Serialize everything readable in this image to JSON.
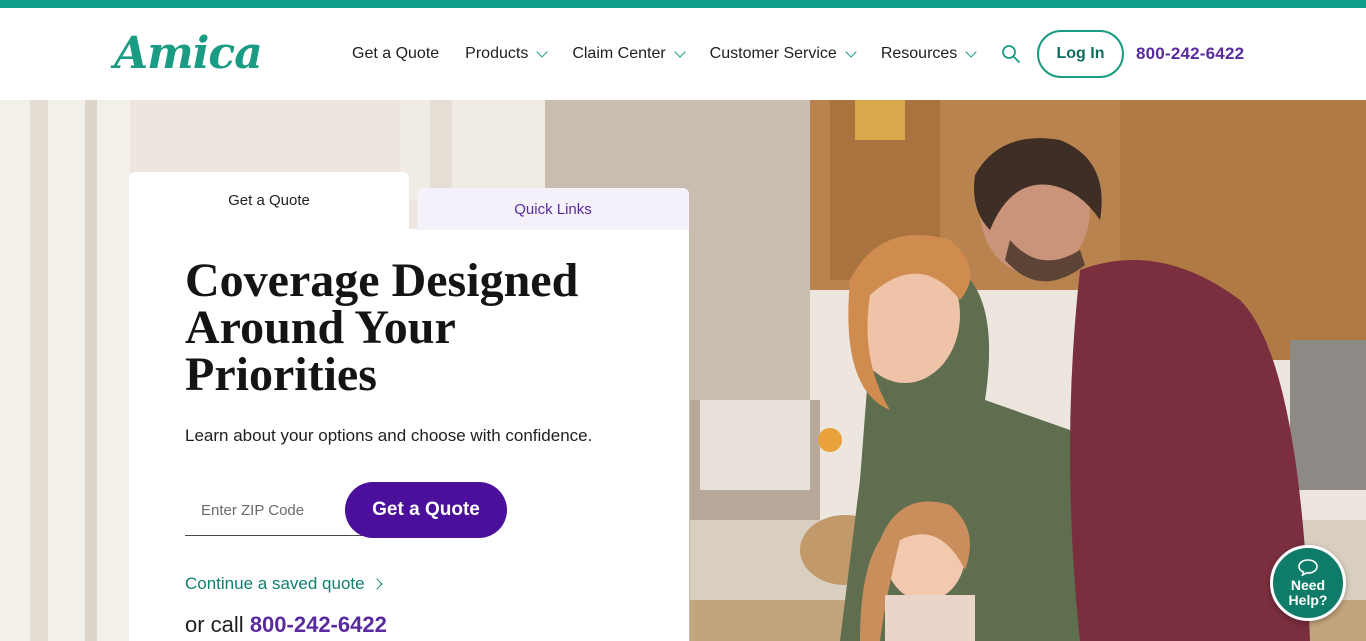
{
  "brand": {
    "logo_text": "Amica",
    "accent": "#0f9f8a",
    "purple": "#4b0f9b"
  },
  "nav": {
    "items": [
      {
        "label": "Get a Quote",
        "has_dropdown": false
      },
      {
        "label": "Products",
        "has_dropdown": true
      },
      {
        "label": "Claim Center",
        "has_dropdown": true
      },
      {
        "label": "Customer Service",
        "has_dropdown": true
      },
      {
        "label": "Resources",
        "has_dropdown": true
      }
    ],
    "search_icon": "search-icon",
    "login_label": "Log In",
    "phone": "800-242-6422"
  },
  "tabs": {
    "quote": "Get a Quote",
    "links": "Quick Links"
  },
  "hero": {
    "headline": "Coverage Designed Around Your Priorities",
    "subtext": "Learn about your options and choose with confidence.",
    "zip_placeholder": "Enter ZIP Code",
    "quote_button": "Get a Quote",
    "saved_quote": "Continue a saved quote",
    "or_call_prefix": "or call",
    "phone": "800-242-6422"
  },
  "help": {
    "line1": "Need",
    "line2": "Help?"
  }
}
